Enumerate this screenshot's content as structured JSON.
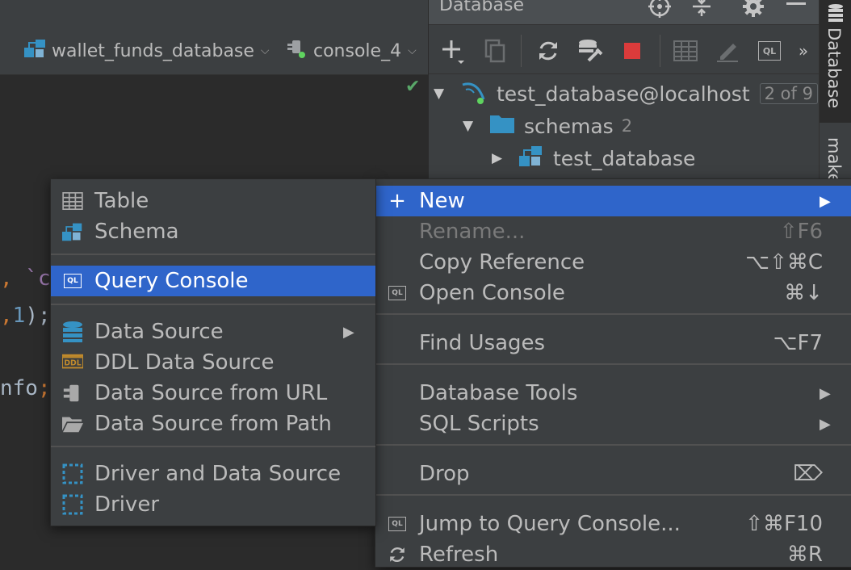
{
  "editor": {
    "datasource": "wallet_funds_database",
    "console": "console_4",
    "code_lines": [
      {
        "pre": ",",
        "text": " `co"
      },
      {
        "pre": ",",
        "num": "1",
        "post": ");"
      },
      {
        "pre": "nfo",
        "post": ";"
      }
    ]
  },
  "db_panel": {
    "title": "Database",
    "header_icons": [
      "crosshair-icon",
      "collapse-icon",
      "gear-icon",
      "minimize-icon"
    ],
    "toolbar_icons": [
      "add-icon",
      "duplicate-icon",
      "refresh-icon",
      "schema-tools-icon",
      "stop-icon",
      "table-icon",
      "edit-icon",
      "ql-console-icon",
      "more-icon"
    ],
    "tree": {
      "connection": "test_database@localhost",
      "connection_badge": "2 of 9",
      "schemas_label": "schemas",
      "schemas_count": "2",
      "schema": "test_database"
    }
  },
  "side_stripe": {
    "tabs": [
      "Database",
      "make"
    ]
  },
  "main_menu": {
    "items": [
      {
        "label": "New",
        "shortcut": "",
        "submenu": true,
        "selected": true,
        "icon": "plus-icon"
      },
      {
        "label": "Rename...",
        "shortcut": "⇧F6",
        "disabled": true
      },
      {
        "label": "Copy Reference",
        "shortcut": "⌥⇧⌘C"
      },
      {
        "label": "Open Console",
        "shortcut": "⌘↓",
        "icon": "ql-console-icon"
      },
      {
        "label": "Find Usages",
        "shortcut": "⌥F7"
      },
      {
        "label": "Database Tools",
        "submenu": true
      },
      {
        "label": "SQL Scripts",
        "submenu": true
      },
      {
        "label": "Drop",
        "shortcut": "⌦"
      },
      {
        "label": "Jump to Query Console...",
        "shortcut": "⇧⌘F10",
        "icon": "ql-console-icon"
      },
      {
        "label": "Refresh",
        "shortcut": "⌘R",
        "icon": "refresh-icon"
      }
    ]
  },
  "new_menu": {
    "items": [
      {
        "label": "Table",
        "icon": "table-icon"
      },
      {
        "label": "Schema",
        "icon": "schema-icon"
      },
      {
        "label": "Query Console",
        "icon": "ql-console-icon",
        "selected": true
      },
      {
        "label": "Data Source",
        "icon": "data-source-icon",
        "submenu": true
      },
      {
        "label": "DDL Data Source",
        "icon": "ddl-icon"
      },
      {
        "label": "Data Source from URL",
        "icon": "plug-icon"
      },
      {
        "label": "Data Source from Path",
        "icon": "folder-icon"
      },
      {
        "label": "Driver and Data Source",
        "icon": "driver-icon"
      },
      {
        "label": "Driver",
        "icon": "driver-icon"
      }
    ]
  },
  "colors": {
    "selection": "#2f65ca",
    "panel_bg": "#3c3f41",
    "editor_bg": "#2b2b2b",
    "folder": "#3592c4",
    "stop": "#db3b3b",
    "ok_check": "#59a869"
  }
}
